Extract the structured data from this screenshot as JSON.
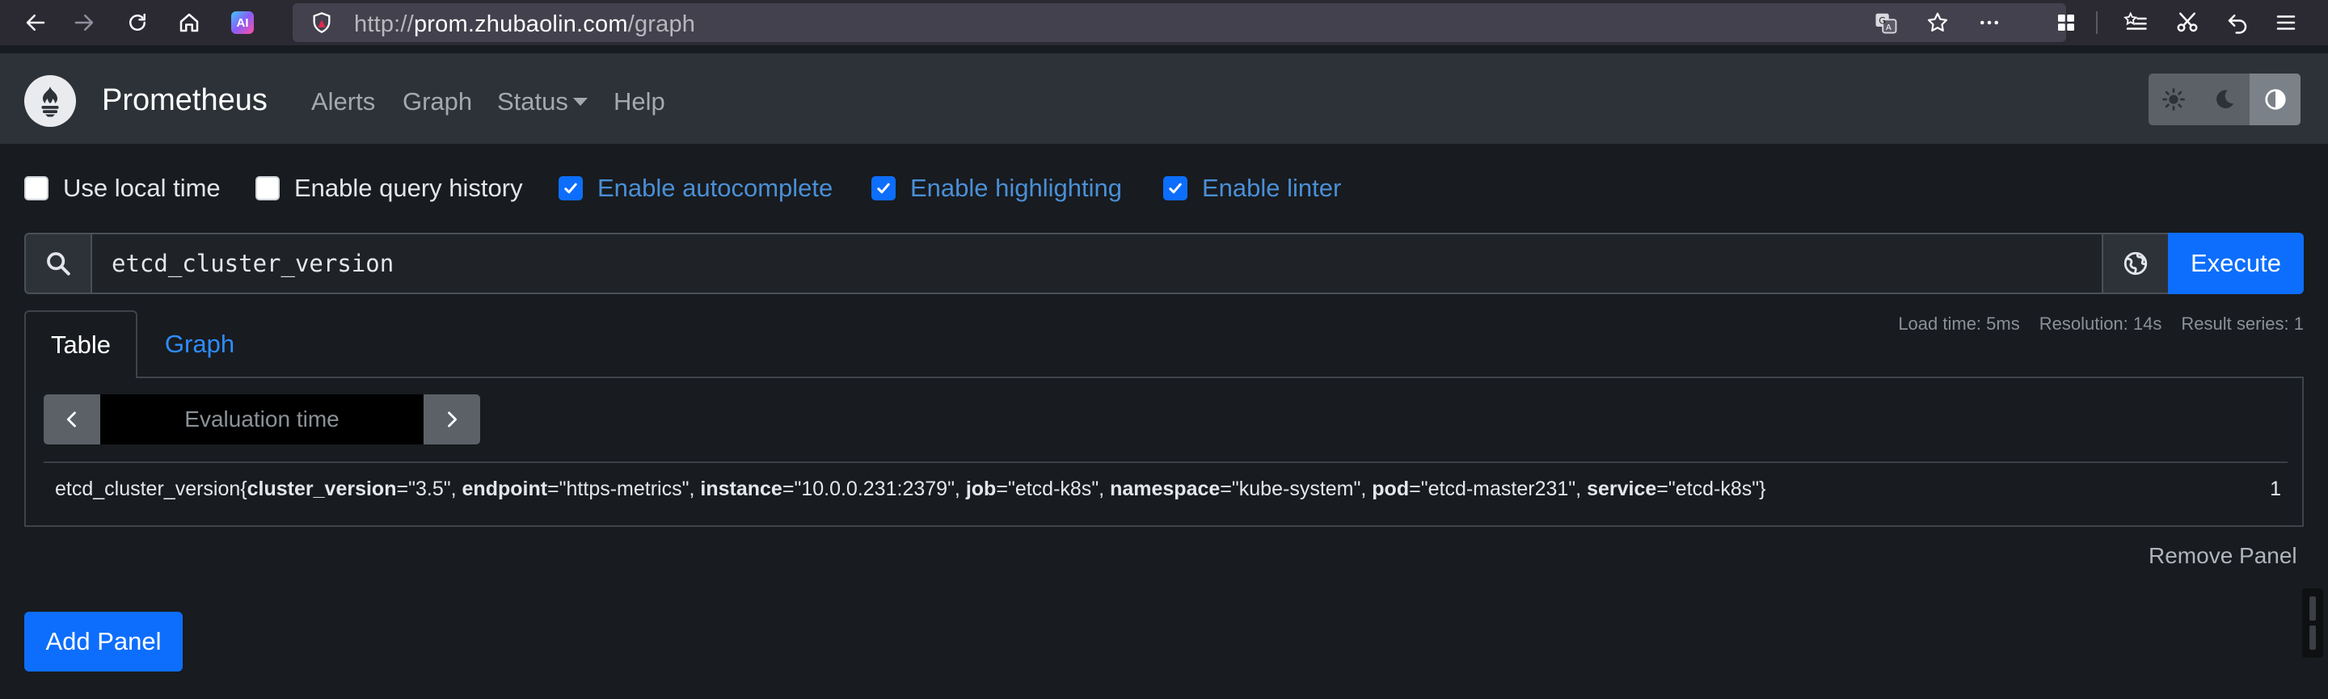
{
  "browser": {
    "url_prefix": "http://",
    "url_host": "prom.zhubaolin.com",
    "url_path": "/graph",
    "ai_badge": "AI"
  },
  "navbar": {
    "brand": "Prometheus",
    "links": [
      "Alerts",
      "Graph",
      "Status",
      "Help"
    ]
  },
  "options": [
    {
      "label": "Use local time",
      "checked": false
    },
    {
      "label": "Enable query history",
      "checked": false
    },
    {
      "label": "Enable autocomplete",
      "checked": true
    },
    {
      "label": "Enable highlighting",
      "checked": true
    },
    {
      "label": "Enable linter",
      "checked": true
    }
  ],
  "query": {
    "expression": "etcd_cluster_version",
    "execute_label": "Execute"
  },
  "stats": {
    "load_time": "Load time: 5ms",
    "resolution": "Resolution: 14s",
    "result_series": "Result series: 1"
  },
  "tabs": {
    "table": "Table",
    "graph": "Graph"
  },
  "panel": {
    "eval_placeholder": "Evaluation time",
    "metric_name": "etcd_cluster_version",
    "labels": [
      {
        "key": "cluster_version",
        "value": "3.5"
      },
      {
        "key": "endpoint",
        "value": "https-metrics"
      },
      {
        "key": "instance",
        "value": "10.0.0.231:2379"
      },
      {
        "key": "job",
        "value": "etcd-k8s"
      },
      {
        "key": "namespace",
        "value": "kube-system"
      },
      {
        "key": "pod",
        "value": "etcd-master231"
      },
      {
        "key": "service",
        "value": "etcd-k8s"
      }
    ],
    "value": "1",
    "remove_label": "Remove Panel"
  },
  "add_panel_label": "Add Panel",
  "colors": {
    "accent": "#0d6efd",
    "navbar": "#2d3238",
    "background": "#181b1f"
  }
}
